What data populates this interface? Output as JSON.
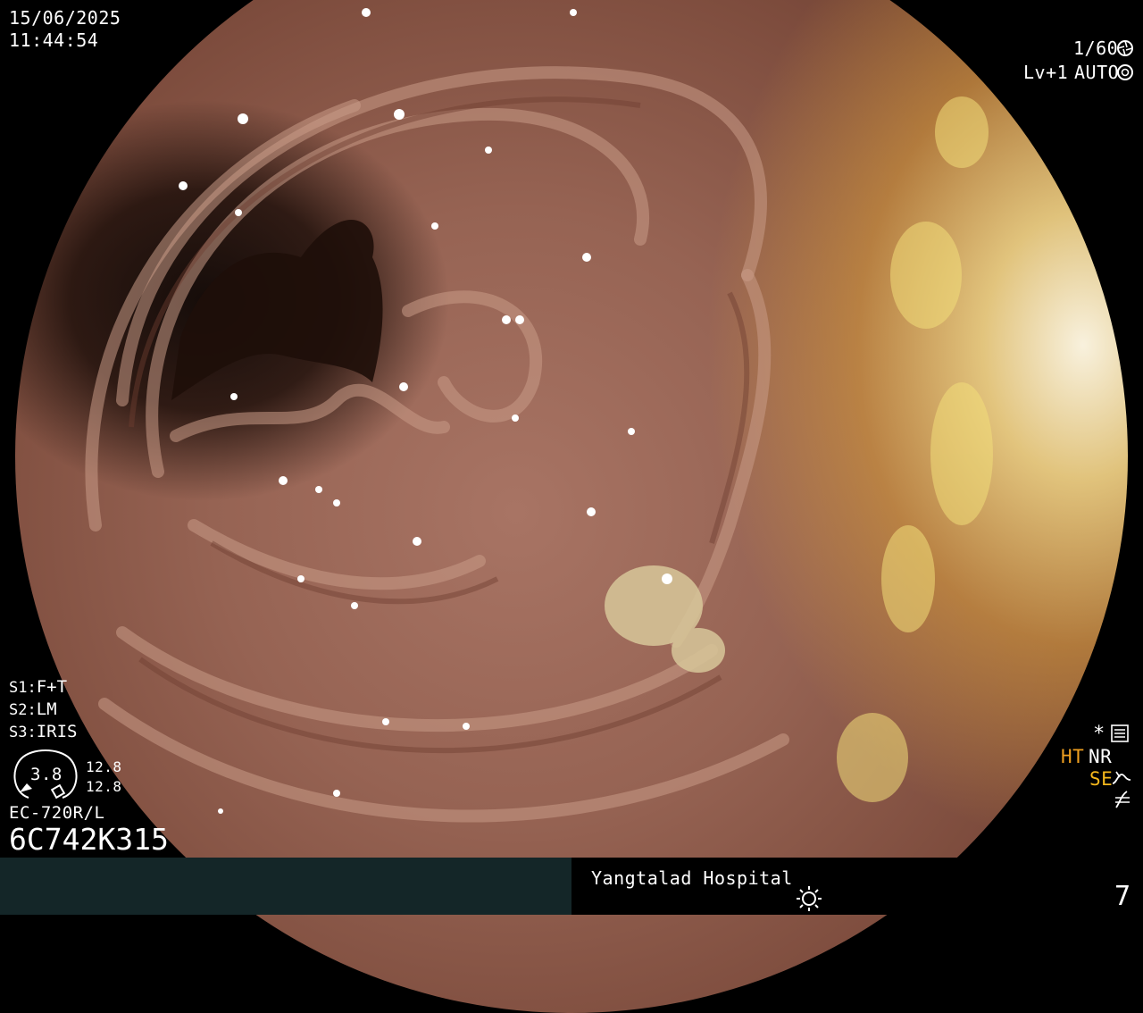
{
  "datetime": {
    "date": "15/06/2025",
    "time": "11:44:54"
  },
  "shutter": {
    "value": "1/60",
    "icon": "shutter-icon"
  },
  "exposure": {
    "level": "Lv+1",
    "mode": "AUTO",
    "icon": "iris-icon"
  },
  "settings": [
    {
      "key": "S1:",
      "value": "F+T"
    },
    {
      "key": "S2:",
      "value": "LM"
    },
    {
      "key": "S3:",
      "value": "IRIS"
    }
  ],
  "gauge": {
    "center": "3.8",
    "top": "12.8",
    "bottom": "12.8"
  },
  "scope_model": "EC-720R/L",
  "scope_serial": "6C742K315",
  "right_indicators": {
    "asterisk": "*",
    "ht": "HT",
    "nr": "NR",
    "se": "SE",
    "menu_icon": "menu-icon",
    "se_icon": "enhance-curve-icon",
    "freeze_icon": "freeze-off-icon"
  },
  "hospital": "Yangtalad Hospital",
  "light_icon": "light-source-icon",
  "page_number": "7",
  "colors": {
    "bar": "#142628",
    "ht": "#f0a020",
    "se": "#f5b81c"
  }
}
